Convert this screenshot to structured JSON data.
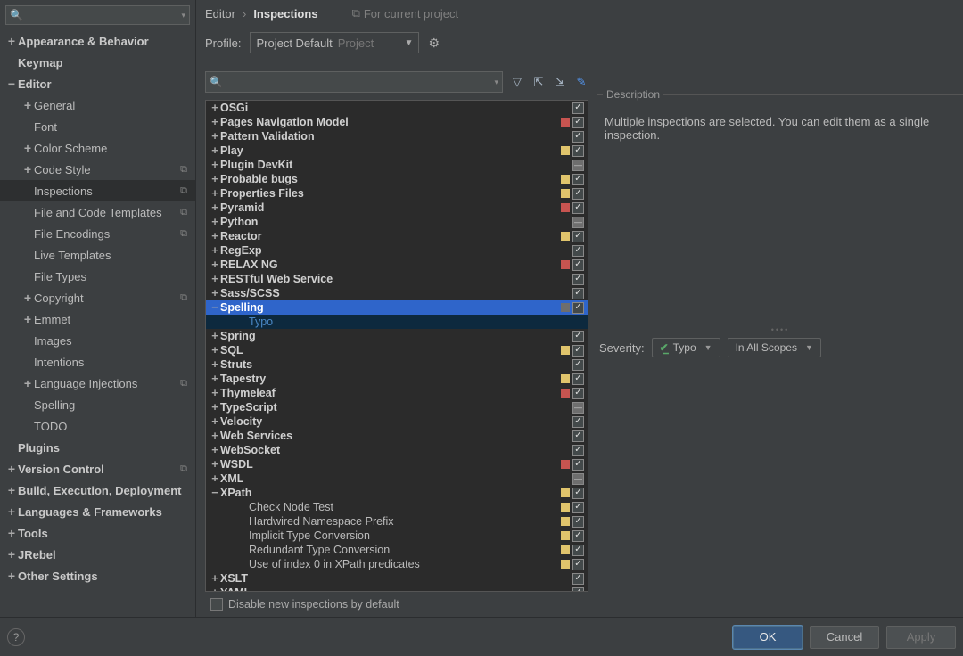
{
  "sidebar": {
    "search_placeholder": "",
    "items": [
      {
        "label": "Appearance & Behavior",
        "exp": "+",
        "bold": true,
        "indent": 0
      },
      {
        "label": "Keymap",
        "exp": "",
        "bold": true,
        "indent": 0
      },
      {
        "label": "Editor",
        "exp": "−",
        "bold": true,
        "indent": 0
      },
      {
        "label": "General",
        "exp": "+",
        "indent": 1
      },
      {
        "label": "Font",
        "exp": "",
        "indent": 1
      },
      {
        "label": "Color Scheme",
        "exp": "+",
        "indent": 1
      },
      {
        "label": "Code Style",
        "exp": "+",
        "indent": 1,
        "badge": true
      },
      {
        "label": "Inspections",
        "exp": "",
        "indent": 1,
        "badge": true,
        "highlight": true
      },
      {
        "label": "File and Code Templates",
        "exp": "",
        "indent": 1,
        "badge": true
      },
      {
        "label": "File Encodings",
        "exp": "",
        "indent": 1,
        "badge": true
      },
      {
        "label": "Live Templates",
        "exp": "",
        "indent": 1
      },
      {
        "label": "File Types",
        "exp": "",
        "indent": 1
      },
      {
        "label": "Copyright",
        "exp": "+",
        "indent": 1,
        "badge": true
      },
      {
        "label": "Emmet",
        "exp": "+",
        "indent": 1
      },
      {
        "label": "Images",
        "exp": "",
        "indent": 1
      },
      {
        "label": "Intentions",
        "exp": "",
        "indent": 1
      },
      {
        "label": "Language Injections",
        "exp": "+",
        "indent": 1,
        "badge": true
      },
      {
        "label": "Spelling",
        "exp": "",
        "indent": 1
      },
      {
        "label": "TODO",
        "exp": "",
        "indent": 1
      },
      {
        "label": "Plugins",
        "exp": "",
        "bold": true,
        "indent": 0
      },
      {
        "label": "Version Control",
        "exp": "+",
        "bold": true,
        "indent": 0,
        "badge": true
      },
      {
        "label": "Build, Execution, Deployment",
        "exp": "+",
        "bold": true,
        "indent": 0
      },
      {
        "label": "Languages & Frameworks",
        "exp": "+",
        "bold": true,
        "indent": 0
      },
      {
        "label": "Tools",
        "exp": "+",
        "bold": true,
        "indent": 0
      },
      {
        "label": "JRebel",
        "exp": "+",
        "bold": true,
        "indent": 0
      },
      {
        "label": "Other Settings",
        "exp": "+",
        "bold": true,
        "indent": 0
      }
    ]
  },
  "breadcrumb": {
    "a": "Editor",
    "b": "Inspections",
    "hint": "For current project"
  },
  "profile": {
    "label": "Profile:",
    "name": "Project Default",
    "suffix": "Project"
  },
  "inspections": {
    "items": [
      {
        "label": "OSGi",
        "exp": "+",
        "bold": true,
        "chk": "on"
      },
      {
        "label": "Pages Navigation Model",
        "exp": "+",
        "bold": true,
        "sev": "red",
        "chk": "on"
      },
      {
        "label": "Pattern Validation",
        "exp": "+",
        "bold": true,
        "chk": "on"
      },
      {
        "label": "Play",
        "exp": "+",
        "bold": true,
        "sev": "yellow",
        "chk": "on"
      },
      {
        "label": "Plugin DevKit",
        "exp": "+",
        "bold": true,
        "chk": "ind"
      },
      {
        "label": "Probable bugs",
        "exp": "+",
        "bold": true,
        "sev": "yellow",
        "chk": "on"
      },
      {
        "label": "Properties Files",
        "exp": "+",
        "bold": true,
        "sev": "yellow",
        "chk": "on"
      },
      {
        "label": "Pyramid",
        "exp": "+",
        "bold": true,
        "sev": "red",
        "chk": "on"
      },
      {
        "label": "Python",
        "exp": "+",
        "bold": true,
        "chk": "ind"
      },
      {
        "label": "Reactor",
        "exp": "+",
        "bold": true,
        "sev": "yellow",
        "chk": "on"
      },
      {
        "label": "RegExp",
        "exp": "+",
        "bold": true,
        "chk": "on"
      },
      {
        "label": "RELAX NG",
        "exp": "+",
        "bold": true,
        "sev": "red",
        "chk": "on"
      },
      {
        "label": "RESTful Web Service",
        "exp": "+",
        "bold": true,
        "chk": "on"
      },
      {
        "label": "Sass/SCSS",
        "exp": "+",
        "bold": true,
        "chk": "on"
      },
      {
        "label": "Spelling",
        "exp": "−",
        "bold": true,
        "sev": "gray",
        "chk": "on",
        "selected": true
      },
      {
        "label": "Typo",
        "exp": "",
        "indent": 2,
        "childsel": true
      },
      {
        "label": "Spring",
        "exp": "+",
        "bold": true,
        "chk": "on"
      },
      {
        "label": "SQL",
        "exp": "+",
        "bold": true,
        "sev": "yellow",
        "chk": "on"
      },
      {
        "label": "Struts",
        "exp": "+",
        "bold": true,
        "chk": "on"
      },
      {
        "label": "Tapestry",
        "exp": "+",
        "bold": true,
        "sev": "yellow",
        "chk": "on"
      },
      {
        "label": "Thymeleaf",
        "exp": "+",
        "bold": true,
        "sev": "red",
        "chk": "on"
      },
      {
        "label": "TypeScript",
        "exp": "+",
        "bold": true,
        "chk": "ind"
      },
      {
        "label": "Velocity",
        "exp": "+",
        "bold": true,
        "chk": "on"
      },
      {
        "label": "Web Services",
        "exp": "+",
        "bold": true,
        "chk": "on"
      },
      {
        "label": "WebSocket",
        "exp": "+",
        "bold": true,
        "chk": "on"
      },
      {
        "label": "WSDL",
        "exp": "+",
        "bold": true,
        "sev": "red",
        "chk": "on"
      },
      {
        "label": "XML",
        "exp": "+",
        "bold": true,
        "chk": "ind"
      },
      {
        "label": "XPath",
        "exp": "−",
        "bold": true,
        "sev": "yellow",
        "chk": "on"
      },
      {
        "label": "Check Node Test",
        "exp": "",
        "indent": 2,
        "sev": "yellow",
        "chk": "on"
      },
      {
        "label": "Hardwired Namespace Prefix",
        "exp": "",
        "indent": 2,
        "sev": "yellow",
        "chk": "on"
      },
      {
        "label": "Implicit Type Conversion",
        "exp": "",
        "indent": 2,
        "sev": "yellow",
        "chk": "on"
      },
      {
        "label": "Redundant Type Conversion",
        "exp": "",
        "indent": 2,
        "sev": "yellow",
        "chk": "on"
      },
      {
        "label": "Use of index 0 in XPath predicates",
        "exp": "",
        "indent": 2,
        "sev": "yellow",
        "chk": "on"
      },
      {
        "label": "XSLT",
        "exp": "+",
        "bold": true,
        "chk": "on"
      },
      {
        "label": "YAML",
        "exp": "+",
        "bold": true,
        "chk": "on"
      }
    ],
    "disable_label": "Disable new inspections by default"
  },
  "desc": {
    "title": "Description",
    "text": "Multiple inspections are selected. You can edit them as a single inspection."
  },
  "severity": {
    "label": "Severity:",
    "value": "Typo",
    "scope": "In All Scopes"
  },
  "footer": {
    "ok": "OK",
    "cancel": "Cancel",
    "apply": "Apply"
  }
}
